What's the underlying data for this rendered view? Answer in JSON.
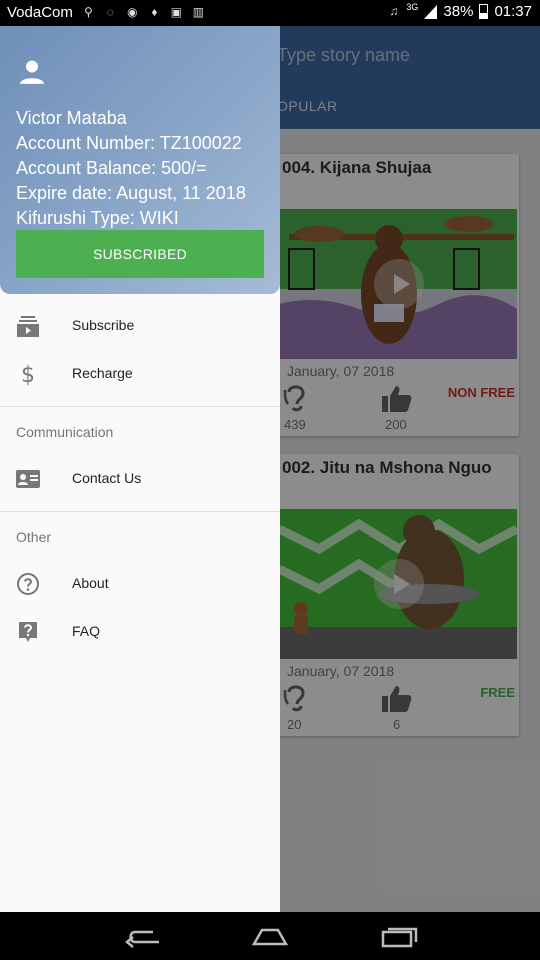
{
  "status_bar": {
    "carrier": "VodaCom",
    "battery": "38%",
    "time": "01:37",
    "network": "3G"
  },
  "app": {
    "search_placeholder": "Type story name",
    "tab": "OPULAR",
    "stories": [
      {
        "title": "004. Kijana Shujaa",
        "date": "January, 07 2018",
        "listens": "439",
        "likes": "200",
        "badge": "NON FREE",
        "badge_color": "#d32f2f"
      },
      {
        "title": "002. Jitu na Mshona Nguo",
        "date": "January, 07 2018",
        "listens": "20",
        "likes": "6",
        "badge": "FREE",
        "badge_color": "#4caf50"
      }
    ]
  },
  "drawer": {
    "user_name": "Victor Mataba",
    "account_number": "Account Number:  TZ100022",
    "account_balance": "Account Balance: 500/=",
    "expire_date": "Expire date: August, 11 2018",
    "kifurushi_type": "Kifurushi Type: WIKI",
    "subscribed_label": "SUBSCRIBED",
    "items": [
      {
        "label": "Subscribe",
        "icon": "subscriptions-icon"
      },
      {
        "label": "Recharge",
        "icon": "dollar-icon"
      }
    ],
    "communication_header": "Communication",
    "communication_items": [
      {
        "label": "Contact Us",
        "icon": "contact-card-icon"
      }
    ],
    "other_header": "Other",
    "other_items": [
      {
        "label": "About",
        "icon": "help-circle-icon"
      },
      {
        "label": "FAQ",
        "icon": "help-box-icon"
      }
    ]
  },
  "colors": {
    "accent_green": "#4caf50",
    "appbar_blue": "#3f6aa6"
  }
}
